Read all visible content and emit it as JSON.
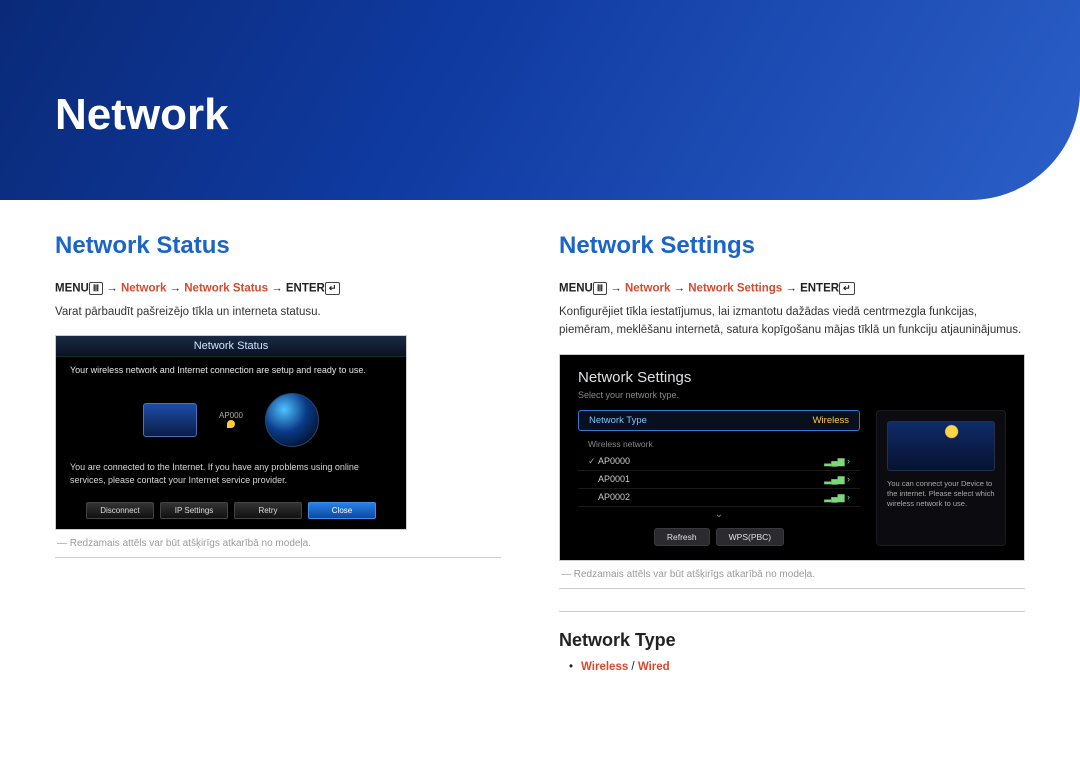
{
  "banner": {
    "title": "Network"
  },
  "left": {
    "heading": "Network Status",
    "path": {
      "menu": "MENU",
      "menu_icon": "Ⅲ",
      "arrow": " → ",
      "seg1": "Network",
      "seg2": "Network Status",
      "enter": "ENTER",
      "enter_icon": "↵"
    },
    "desc": "Varat pārbaudīt pašreizējo tīkla un interneta statusu.",
    "shot": {
      "title": "Network Status",
      "msg": "Your wireless network and Internet connection are setup and ready to use.",
      "ap_label": "AP000",
      "info2": "You are connected to the Internet. If you have any problems using online services, please contact your Internet service provider.",
      "buttons": [
        "Disconnect",
        "IP Settings",
        "Retry",
        "Close"
      ]
    },
    "note": "― Redzamais attēls var būt atšķirīgs atkarībā no modeļa."
  },
  "right": {
    "heading": "Network Settings",
    "path": {
      "menu": "MENU",
      "menu_icon": "Ⅲ",
      "arrow": " → ",
      "seg1": "Network",
      "seg2": "Network Settings",
      "enter": "ENTER",
      "enter_icon": "↵"
    },
    "desc": "Konfigurējiet tīkla iestatījumus, lai izmantotu dažādas viedā centrmezgla funkcijas, piemēram, meklēšanu internetā, satura kopīgošanu mājas tīklā un funkciju atjauninājumus.",
    "shot": {
      "title": "Network Settings",
      "subtitle": "Select your network type.",
      "row_label": "Network Type",
      "row_value": "Wireless",
      "wnet_label": "Wireless network",
      "aps": [
        "AP0000",
        "AP0001",
        "AP0002"
      ],
      "btn1": "Refresh",
      "btn2": "WPS(PBC)",
      "side_text": "You can connect your Device to the internet. Please select which wireless network to use."
    },
    "note": "― Redzamais attēls var būt atšķirīgs atkarībā no modeļa.",
    "subheading": "Network Type",
    "options": {
      "a": "Wireless",
      "sep": " / ",
      "b": "Wired"
    }
  }
}
